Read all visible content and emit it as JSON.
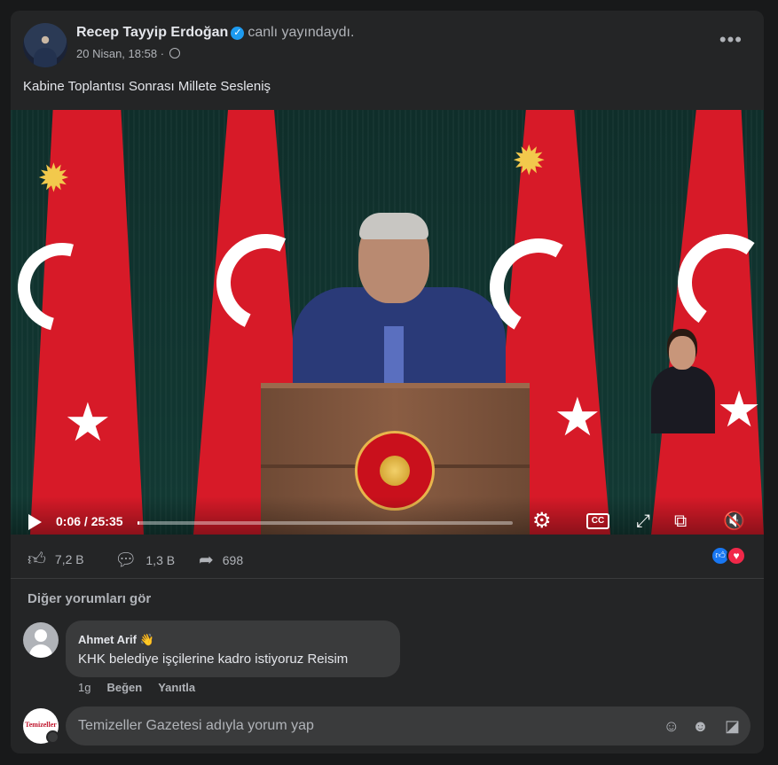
{
  "post": {
    "author": "Recep Tayyip Erdoğan",
    "status": "canlı yayındaydı.",
    "date": "20 Nisan, 18:58",
    "separator": "·",
    "caption": "Kabine Toplantısı Sonrası Millete Sesleniş",
    "more_label": "•••"
  },
  "video": {
    "current_time": "0:06",
    "duration": "25:35",
    "time_separator": " / ",
    "progress_fraction": 0.004,
    "cc_label": "CC"
  },
  "stats": {
    "likes": "7,2 B",
    "comments": "1,3 B",
    "shares": "698"
  },
  "comments": {
    "more_label": "Diğer yorumları gör",
    "items": [
      {
        "author": "Ahmet Arif",
        "text": "KHK belediye işçilerine kadro istiyoruz Reisim",
        "time": "1g",
        "like_label": "Beğen",
        "reply_label": "Yanıtla"
      }
    ]
  },
  "composer": {
    "placeholder": "Temizeller Gazetesi adıyla yorum yap",
    "avatar_text": "Temizeller"
  },
  "colors": {
    "background": "#18191a",
    "card": "#242526",
    "bubble": "#3a3b3c",
    "accent_blue": "#1877f2",
    "love_red": "#f02849",
    "flag_red": "#d71a28"
  }
}
